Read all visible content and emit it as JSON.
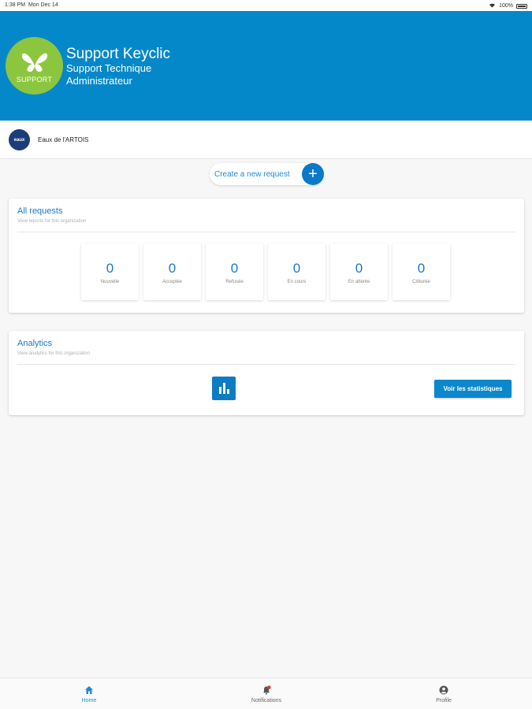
{
  "status_bar": {
    "time": "1:38 PM",
    "date": "Mon Dec 14",
    "battery": "100%"
  },
  "header": {
    "logo_text": "SUPPORT",
    "title": "Support Keyclic",
    "subtitle_1": "Support Technique",
    "subtitle_2": "Administrateur"
  },
  "organization": {
    "avatar_text": "eaux",
    "name": "Eaux de l'ARTOIS"
  },
  "create_request": {
    "label": "Create a new request",
    "icon": "plus-icon"
  },
  "requests": {
    "title": "All requests",
    "subtitle": "View reports for this organization",
    "stats": [
      {
        "value": "0",
        "label": "Nouvelle"
      },
      {
        "value": "0",
        "label": "Acceptée"
      },
      {
        "value": "0",
        "label": "Refusée"
      },
      {
        "value": "0",
        "label": "En cours"
      },
      {
        "value": "0",
        "label": "En attente"
      },
      {
        "value": "0",
        "label": "Clôturée"
      }
    ]
  },
  "analytics": {
    "title": "Analytics",
    "subtitle": "View analytics for this organization",
    "chart_icon": "bar-chart-icon",
    "button_label": "Voir les statistiques"
  },
  "tabs": [
    {
      "label": "Home",
      "icon": "home-icon",
      "active": true
    },
    {
      "label": "Notifications",
      "icon": "bell-icon",
      "active": false
    },
    {
      "label": "Profile",
      "icon": "user-icon",
      "active": false
    }
  ],
  "colors": {
    "header": "#0588c9",
    "accent": "#1a79c4",
    "logo": "#8cc63f",
    "button": "#0b87cc"
  }
}
